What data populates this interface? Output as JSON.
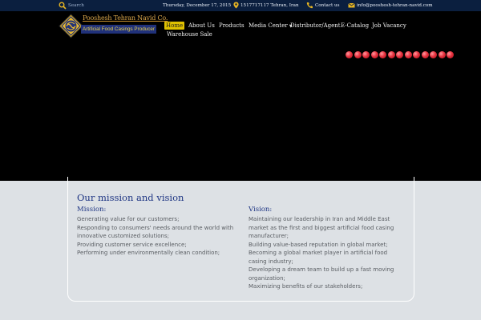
{
  "topbar": {
    "search_placeholder": "Search",
    "date": "Thursday, December 17, 2015",
    "location": "1517717117 Tehran, Iran",
    "contact": "Contact us",
    "email": "info@pooshesh-tehran-navid.com"
  },
  "logo": {
    "name": "Pooshesh Tehran Navid Co.",
    "tagline": "Artificial Food Casings Producer"
  },
  "nav": {
    "home": "Home",
    "about": "About Us",
    "products": "Products",
    "media": "Media Center",
    "distributor": "Distributor/Agent",
    "ecatalog": "E-Catalog",
    "jobs": "Job Vacancy",
    "warehouse": "Warehouse Sale"
  },
  "slider": {
    "dot_count": 13,
    "dot_color": "#e8323f"
  },
  "content": {
    "title": "Our mission and vision",
    "mission_heading": "Mission:",
    "mission_items": [
      "Generating value for our customers;",
      "Responding to consumers' needs around the world with innovative customized solutions;",
      "Providing customer service excellence;",
      "Performing under environmentally clean condition;"
    ],
    "vision_heading": "Vision:",
    "vision_items": [
      "Maintaining our leadership in Iran and Middle East market as the first and biggest artificial food casing manufacturer;",
      "Building value-based reputation in global market;",
      "Becoming a global market player in artificial food casing industry;",
      "Developing a dream team to build up a fast moving organization;",
      "Maximizing benefits of our stakeholders;"
    ]
  },
  "colors": {
    "topbar_bg": "#0b1f3f",
    "accent_yellow": "#e0c100",
    "heading_blue": "#1e3583",
    "content_bg": "#dde1e5"
  }
}
